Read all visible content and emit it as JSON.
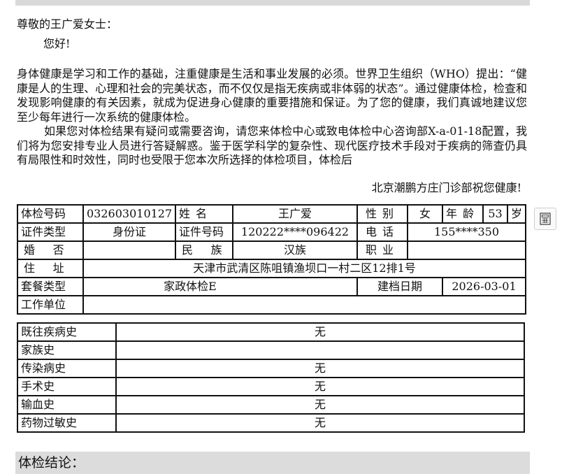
{
  "letter": {
    "greeting": "尊敬的王广爱女士：",
    "hello": "您好!",
    "paragraph1": "身体健康是学习和工作的基础，注重健康是生活和事业发展的必须。世界卫生组织（WHO）提出：“健康是人的生理、心理和社会的完美状态，而不仅仅是指无疾病或非体弱的状态”。通过健康体检，检查和发现影响健康的有关因素，就成为促进身心健康的重要措施和保证。为了您的健康，我们真诚地建议您至少每年进行一次系统的健康体检。",
    "paragraph2": "如果您对体检结果有疑问或需要咨询，请您来体检中心或致电体检中心咨询部X-a-01-18配置，我们将为您安排专业人员进行答疑解惑。鉴于医学科学的复杂性、现代医疗技术手段对于疾病的筛查仍具有局限性和时效性，同时也受限于您本次所选择的体检项目，体检后",
    "signature": "北京潮鹏方庄门诊部祝您健康!"
  },
  "side_button": {
    "icon": "calculator-icon"
  },
  "info": {
    "exam_no_label": "体检号码",
    "exam_no": "032603010127",
    "name_label": "姓名",
    "name": "王广爱",
    "gender_label": "性别",
    "gender": "女",
    "age_label": "年龄",
    "age": "53",
    "age_unit": "岁",
    "id_type_label": "证件类型",
    "id_type": "身份证",
    "id_no_label": "证件号码",
    "id_no": "120222****096422",
    "phone_label": "电话",
    "phone": "155****350",
    "marital_label": "婚否",
    "marital": "",
    "ethnicity_label": "民族",
    "ethnicity": "汉族",
    "occupation_label": "职业",
    "occupation": "",
    "address_label": "住址",
    "address": "天津市武清区陈咀镇渔坝口一村二区12排1号",
    "package_label": "套餐类型",
    "package": "家政体检E",
    "created_label": "建档日期",
    "created": "2026-03-01",
    "employer_label": "工作单位",
    "employer": ""
  },
  "history": [
    {
      "label": "既往疾病史",
      "value": "无"
    },
    {
      "label": "家族史",
      "value": ""
    },
    {
      "label": "传染病史",
      "value": "无"
    },
    {
      "label": "手术史",
      "value": "无"
    },
    {
      "label": "输血史",
      "value": "无"
    },
    {
      "label": "药物过敏史",
      "value": "无"
    }
  ],
  "conclusion": {
    "title": "体检结论："
  }
}
